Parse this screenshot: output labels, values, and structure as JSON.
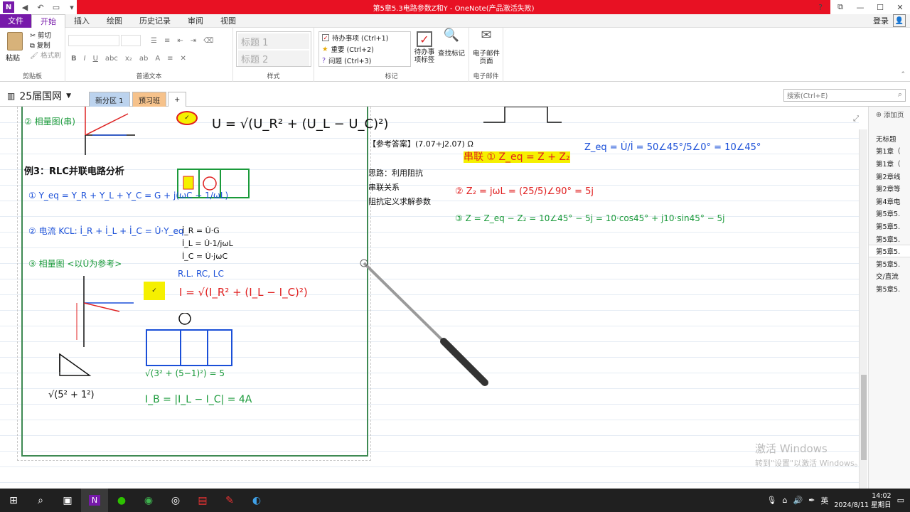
{
  "titlebar": {
    "title": "第5章5.3电路参数Z和Y - OneNote(产品激活失败)",
    "controls": [
      "?",
      "⧉",
      "—",
      "☐",
      "✕"
    ]
  },
  "menu": {
    "file": "文件",
    "tabs": [
      "开始",
      "插入",
      "绘图",
      "历史记录",
      "审阅",
      "视图"
    ],
    "login": "登录"
  },
  "ribbon": {
    "clipboard": {
      "paste": "粘贴",
      "cut": "剪切",
      "copy": "复制",
      "format_painter": "格式刷",
      "label": "剪贴板"
    },
    "basic_text": {
      "label": "普通文本",
      "bold": "B",
      "italic": "I",
      "underline": "U"
    },
    "styles": {
      "heading1": "标题 1",
      "heading2": "标题 2",
      "label": "样式"
    },
    "tags": {
      "todo": "待办事项 (Ctrl+1)",
      "important": "重要 (Ctrl+2)",
      "question": "问题 (Ctrl+3)",
      "label": "标记"
    },
    "todo_tag": "待办事项标签",
    "find_tags": "查找标记",
    "email": {
      "button": "电子邮件页面",
      "label": "电子邮件"
    }
  },
  "notebook": {
    "name": "25届国网",
    "sections": [
      "新分区 1",
      "预习班"
    ],
    "add_section": "+",
    "search_placeholder": "搜索(Ctrl+E)"
  },
  "note": {
    "phasor_title": "② 相量图(串)",
    "formula_top": "U = √(U_R² + (U_L − U_C)²)",
    "example_title": "例3：RLC并联电路分析",
    "step1": "① Y_eq = Y_R + Y_L + Y_C = G + j(ωC − 1/ωL)",
    "step2": "② 电流 KCL: İ_R + İ_L + İ_C = U̇·Y_eq",
    "step3": "③ 相量图 <以U̇为参考>",
    "formula_I": "I = √(I_R² + (I_L − I_C)²)",
    "parallel_labels": [
      "İ_R = U̇·G",
      "İ_L = U̇·1/jωL",
      "İ_C = U̇·jωC"
    ],
    "rlc_labels": "R.L. RC, LC",
    "calc1": "√(3² + (5−1)²) = 5",
    "calc2": "I_B = |I_L − I_C| = 4A",
    "ref_answer": "【参考答案】(7.07+j2.07) Ω",
    "series_eq": "串联 ① Z_eq = Z + Z₂",
    "zeq_calc": "Z_eq = U̇/İ = 50∠45°/5∠0° = 10∠45°",
    "z2": "② Z₂ = jωL = (25/5)∠90° = 5j",
    "z_final": "③ Z = Z_eq − Z₂ = 10∠45° − 5j = 10·cos45° + j10·sin45° − 5j",
    "notes": [
      "思路：利用阻抗",
      "串联关系",
      "阻抗定义求解参数"
    ]
  },
  "pages": {
    "add": "添加页",
    "items": [
      "无标题",
      "第1章（",
      "第1章（",
      "第2章线",
      "第2章等",
      "第4章电",
      "第5章5.",
      "第5章5.",
      "第5章5.",
      "第5章5.",
      "第5章5.",
      "交/直流",
      "第5章5."
    ],
    "selected_index": 9
  },
  "watermark": {
    "line1": "激活 Windows",
    "line2": "转到\"设置\"以激活 Windows。"
  },
  "taskbar": {
    "time": "14:02",
    "date": "2024/8/11 星期日",
    "lang": "英"
  },
  "colors": {
    "accent": "#7719aa",
    "title_red": "#e81123",
    "ink_black": "#111111",
    "ink_blue": "#1a4fd8",
    "ink_red": "#e02020",
    "ink_green": "#1a9a3a",
    "highlight": "#f5f000"
  }
}
